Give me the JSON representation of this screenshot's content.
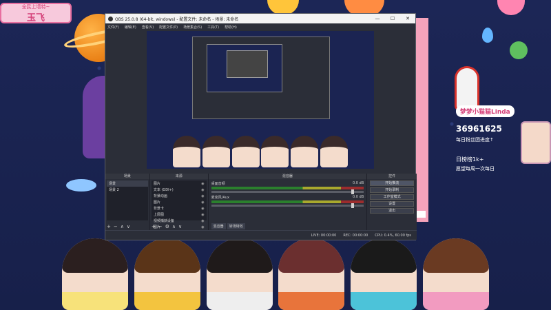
{
  "badge": {
    "top_text": "全民上墙特~",
    "name": "玉飞"
  },
  "streamer": {
    "name": "梦梦小猫猫Linda",
    "fans": "36961625",
    "fans_note": "每日粉丝团进度↑",
    "daily": "日榜榜1k+",
    "daily_note": "愿望每周一次每日"
  },
  "window": {
    "title": "OBS 25.0.8 (64-bit, windows) - 配置文件: 未命名 - 场景: 未命名",
    "minimize": "—",
    "maximize": "☐",
    "close": "✕"
  },
  "menu": [
    "文件(F)",
    "编辑(E)",
    "查看(V)",
    "配置文件(P)",
    "场景集合(S)",
    "工具(T)",
    "帮助(H)"
  ],
  "panels": {
    "scenes_title": "场景",
    "sources_title": "来源",
    "mixer_title": "混音器",
    "controls_title": "控件",
    "scenes": [
      "场景",
      "场景 2"
    ],
    "sources": [
      "图片",
      "文本 (GDI+)",
      "背景动画",
      "图片",
      "背景卡",
      "上层图",
      "视频捕获设备",
      "图片"
    ],
    "mixer_tracks": [
      {
        "name": "桌面音频",
        "db": "0.0 dB"
      },
      {
        "name": "麦克风/Aux",
        "db": "0.0 dB"
      }
    ],
    "mixer_tabs": [
      "混音器",
      "转场特效"
    ],
    "controls": [
      "开始推流",
      "开始录制",
      "工作室模式",
      "设置",
      "退出"
    ],
    "tools": {
      "add": "+",
      "remove": "−",
      "up": "∧",
      "down": "∨",
      "settings": "⚙"
    }
  },
  "status": {
    "live": "LIVE: 00:00:00",
    "rec": "REC: 00:00:00",
    "cpu": "CPU: 0.4%, 60.00 fps"
  }
}
